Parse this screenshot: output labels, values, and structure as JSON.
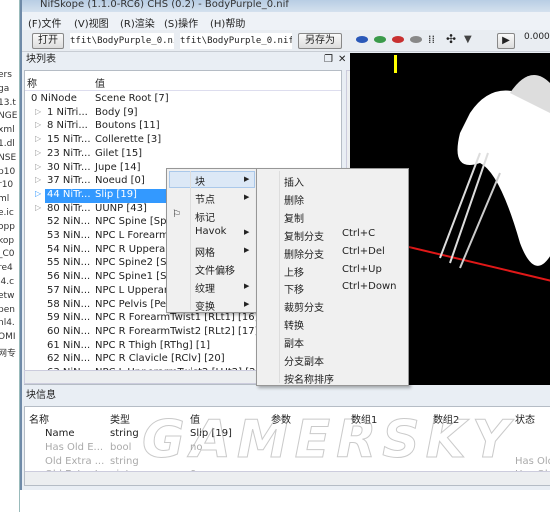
{
  "desktop": {
    "files": [
      "ers",
      "ga",
      "13.t",
      "NGE",
      "xml",
      "1.dl",
      "NSE",
      "p10",
      "r10",
      "ml",
      "e.ic",
      "opp",
      "kop",
      "_C0",
      "re4",
      "i4.c",
      "etw",
      "pen",
      "nl4.",
      "OMI",
      "网专"
    ]
  },
  "window": {
    "title": "NifSkope (1.1.0-RC6) CHS (0.2) - BodyPurple_0.nif"
  },
  "menu": [
    "(F)文件",
    "(V)视图",
    "(R)渲染",
    "(S)操作",
    "(H)帮助"
  ],
  "toolbar": {
    "open_label": "打开",
    "load_path": "tfit\\BodyPurple_0.nif",
    "save_path": "tfit\\BodyPurple_0.nif",
    "save_as_label": "另存为",
    "time": "0.000",
    "icons": [
      "blue-mesh-icon",
      "green-mesh-icon",
      "red-mesh-icon",
      "gray-mesh-icon",
      "footprints-icon",
      "axes-icon",
      "dropdown-icon",
      "play-icon"
    ]
  },
  "block_list": {
    "title": "块列表",
    "col_name": "称",
    "col_value": "值",
    "rows": [
      {
        "name": "0 NiNode",
        "value": "Scene Root [7]",
        "expander": false,
        "indent": 0
      },
      {
        "name": "1 NiTri...",
        "value": "Body [9]",
        "expander": true
      },
      {
        "name": "8 NiTri...",
        "value": "Boutons [11]",
        "expander": true
      },
      {
        "name": "15 NiTr...",
        "value": "Collerette [3]",
        "expander": true
      },
      {
        "name": "23 NiTr...",
        "value": "Gilet [15]",
        "expander": true
      },
      {
        "name": "30 NiTr...",
        "value": "Jupe [14]",
        "expander": true
      },
      {
        "name": "37 NiTr...",
        "value": "Noeud [0]",
        "expander": true
      },
      {
        "name": "44 NiTr...",
        "value": "Slip [19]",
        "expander": true,
        "selected": true
      },
      {
        "name": "80 NiTr...",
        "value": "UUNP [43]",
        "expander": true
      },
      {
        "name": "52 NiN...",
        "value": "NPC Spine [Spn"
      },
      {
        "name": "53 NiN...",
        "value": "NPC L Forearm"
      },
      {
        "name": "54 NiN...",
        "value": "NPC R Upperar"
      },
      {
        "name": "55 NiN...",
        "value": "NPC Spine2 [Sp"
      },
      {
        "name": "56 NiN...",
        "value": "NPC Spine1 [Sp"
      },
      {
        "name": "57 NiN...",
        "value": "NPC L Upperar"
      },
      {
        "name": "58 NiN...",
        "value": "NPC Pelvis [Pelv"
      },
      {
        "name": "59 NiN...",
        "value": "NPC R ForearmTwist1 [RLt1] [16]"
      },
      {
        "name": "60 NiN...",
        "value": "NPC R ForearmTwist2 [RLt2] [17]"
      },
      {
        "name": "61 NiN...",
        "value": "NPC R Thigh [RThg] [1]"
      },
      {
        "name": "62 NiN...",
        "value": "NPC R Clavicle [RClv] [20]"
      },
      {
        "name": "63 NiN...",
        "value": "NPC L UpperarmTwist2 [LUt2] [21]"
      }
    ]
  },
  "context_menu": {
    "items": [
      {
        "label": "块",
        "submenu": true,
        "active": true
      },
      {
        "label": "节点",
        "submenu": true
      },
      {
        "label": "标记",
        "icon": "flag-icon"
      },
      {
        "label": "Havok",
        "submenu": true
      },
      {
        "label": "网格",
        "submenu": true
      },
      {
        "label": "文件偏移"
      },
      {
        "label": "纹理",
        "submenu": true
      },
      {
        "label": "变换",
        "submenu": true
      }
    ]
  },
  "submenu": {
    "items": [
      {
        "label": "插入",
        "shortcut": ""
      },
      {
        "label": "删除",
        "shortcut": ""
      },
      {
        "label": "复制",
        "shortcut": ""
      },
      {
        "label": "复制分支",
        "shortcut": "Ctrl+C"
      },
      {
        "label": "删除分支",
        "shortcut": "Ctrl+Del"
      },
      {
        "label": "上移",
        "shortcut": "Ctrl+Up"
      },
      {
        "label": "下移",
        "shortcut": "Ctrl+Down"
      },
      {
        "label": "裁剪分支",
        "shortcut": ""
      },
      {
        "label": "转换",
        "shortcut": ""
      },
      {
        "label": "副本",
        "shortcut": ""
      },
      {
        "label": "分支副本",
        "shortcut": ""
      },
      {
        "label": "按名称排序",
        "shortcut": ""
      }
    ]
  },
  "block_info": {
    "title": "块信息",
    "columns": [
      "名称",
      "类型",
      "值",
      "参数",
      "数组1",
      "数组2",
      "状态"
    ],
    "rows": [
      {
        "name": "Name",
        "type": "string",
        "value": "Slip [19]",
        "cond": "",
        "dim": false
      },
      {
        "name": "Has Old E...",
        "type": "bool",
        "value": "no",
        "cond": "",
        "dim": true
      },
      {
        "name": "Old Extra ...",
        "type": "string",
        "value": "",
        "cond": "Has Old",
        "dim": true
      },
      {
        "name": "Old Extra I...",
        "type": "uint",
        "value": "0",
        "cond": "Has Old",
        "dim": true
      }
    ]
  },
  "watermark": "GAMERSKY"
}
